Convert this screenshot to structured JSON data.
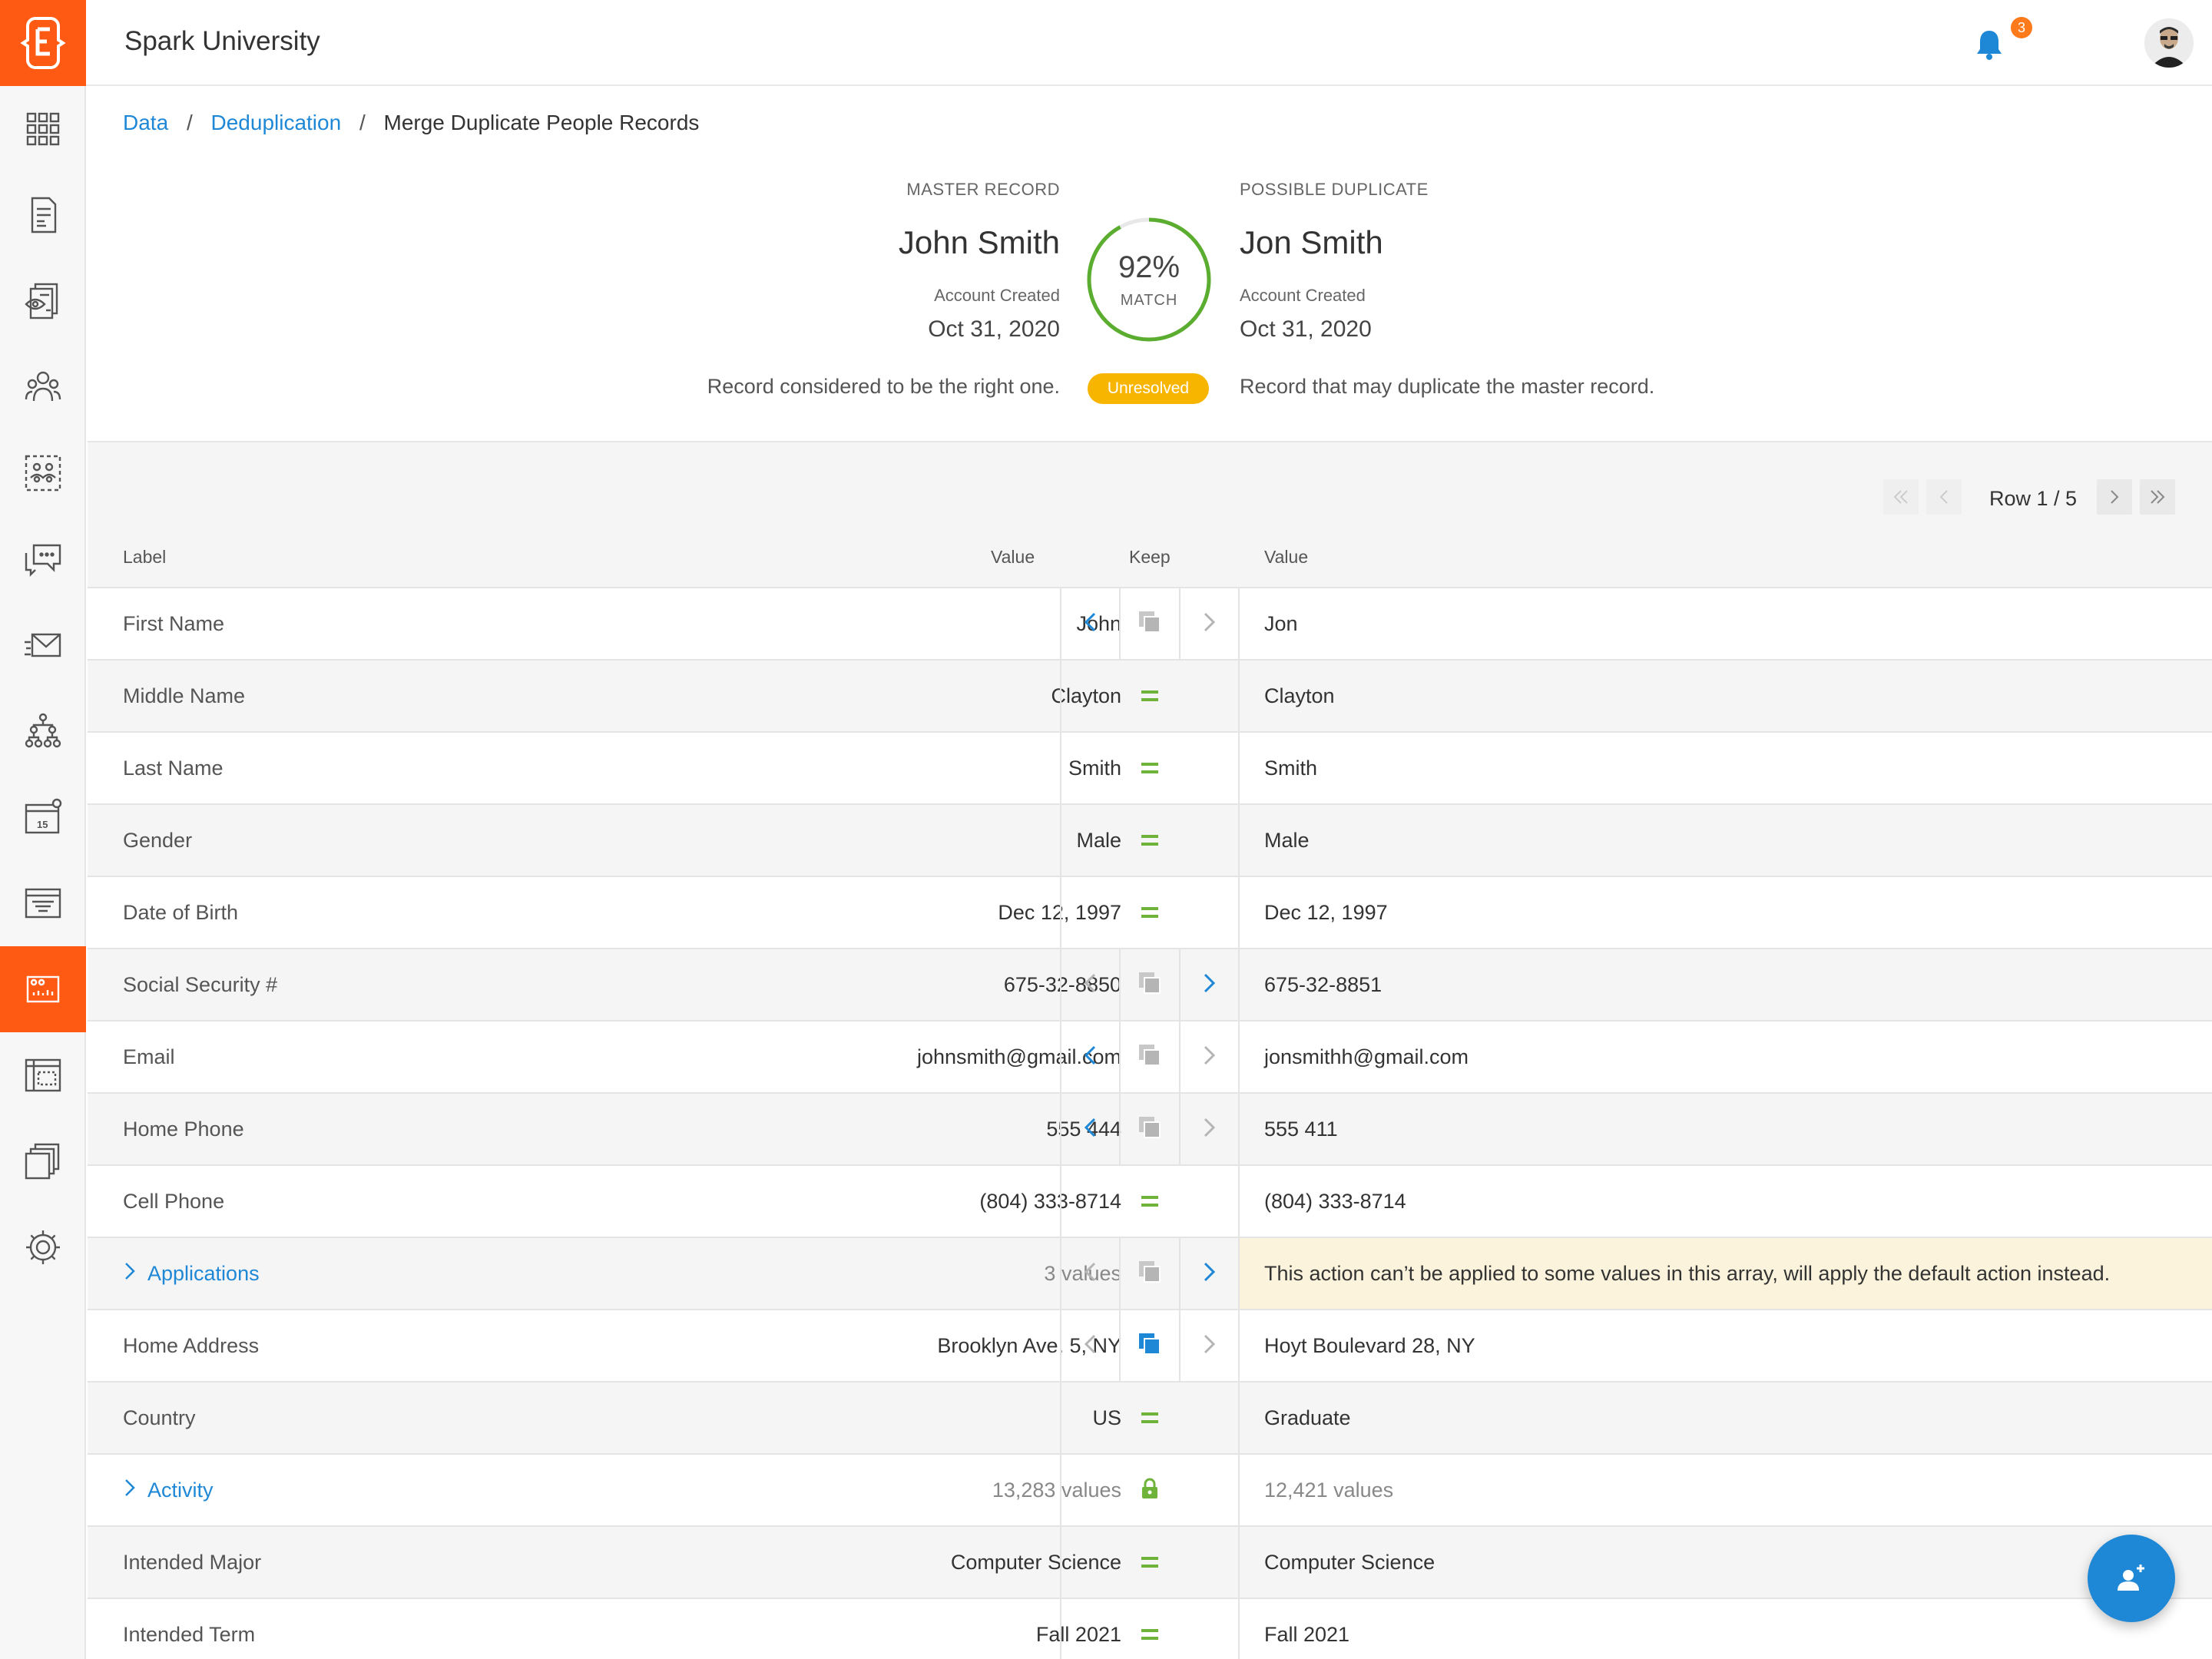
{
  "app": {
    "title": "Spark University",
    "notification_count": "3"
  },
  "breadcrumb": {
    "items": [
      "Data",
      "Deduplication",
      "Merge Duplicate People Records"
    ],
    "separator": "/"
  },
  "master": {
    "caption": "MASTER RECORD",
    "name": "John Smith",
    "created_label": "Account Created",
    "created_date": "Oct 31, 2020",
    "description": "Record considered to be the right one."
  },
  "duplicate": {
    "caption": "POSSIBLE DUPLICATE",
    "name": "Jon Smith",
    "created_label": "Account Created",
    "created_date": "Oct 31, 2020",
    "description": "Record that may duplicate the master record."
  },
  "match": {
    "percent_text": "92%",
    "percent": 92,
    "label": "MATCH",
    "status": "Unresolved"
  },
  "pager": {
    "text": "Row 1 / 5"
  },
  "columns": {
    "label": "Label",
    "value": "Value",
    "keep": "Keep",
    "value2": "Value"
  },
  "rows": [
    {
      "label": "First Name",
      "master": "John",
      "keep": "arrows",
      "active": "left",
      "dup": "Jon"
    },
    {
      "label": "Middle Name",
      "master": "Clayton",
      "keep": "equal",
      "dup": "Clayton"
    },
    {
      "label": "Last Name",
      "master": "Smith",
      "keep": "equal",
      "dup": "Smith"
    },
    {
      "label": "Gender",
      "master": "Male",
      "keep": "equal",
      "dup": "Male"
    },
    {
      "label": "Date of Birth",
      "master": "Dec 12, 1997",
      "keep": "equal",
      "dup": "Dec 12, 1997"
    },
    {
      "label": "Social Security #",
      "master": "675-32-8850",
      "keep": "arrows",
      "active": "right",
      "dup": "675-32-8851"
    },
    {
      "label": "Email",
      "master": "johnsmith@gmail.com",
      "keep": "arrows",
      "active": "left",
      "dup": "jonsmithh@gmail.com"
    },
    {
      "label": "Home Phone",
      "master": "555 444",
      "keep": "arrows",
      "active": "left",
      "dup": "555 411"
    },
    {
      "label": "Cell Phone",
      "master": "(804) 333-8714",
      "keep": "equal",
      "dup": "(804) 333-8714"
    },
    {
      "label": "Applications",
      "master": "3 values",
      "keep": "arrows",
      "active": "right",
      "dup": "This action can’t be applied to some values in this array, will apply the default action instead.",
      "expandable": true,
      "warning": true
    },
    {
      "label": "Home Address",
      "master": "Brooklyn Ave. 5, NY",
      "keep": "arrows",
      "active": "both",
      "dup": "Hoyt Boulevard 28, NY"
    },
    {
      "label": "Country",
      "master": "US",
      "keep": "equal",
      "dup": "Graduate"
    },
    {
      "label": "Activity",
      "master": "13,283 values",
      "keep": "lock",
      "dup": "12,421 values",
      "expandable": true
    },
    {
      "label": "Intended Major",
      "master": "Computer Science",
      "keep": "equal",
      "dup": "Computer Science"
    },
    {
      "label": "Intended Term",
      "master": "Fall 2021",
      "keep": "equal",
      "dup": "Fall 2021"
    }
  ],
  "colors": {
    "brand": "#ff5a13",
    "accent": "#1e88d6",
    "equal": "#6fb33a",
    "pill": "#f7b500",
    "warning_bg": "#fcf3dc"
  },
  "sidebar_icons": [
    "apps-grid-icon",
    "form-icon",
    "documents-review-icon",
    "people-group-icon",
    "audience-selection-icon",
    "chat-icon",
    "send-mail-icon",
    "hierarchy-icon",
    "calendar-icon",
    "filter-card-icon",
    "data-dedupe-icon",
    "table-builder-icon",
    "files-stack-icon",
    "settings-gear-icon"
  ]
}
